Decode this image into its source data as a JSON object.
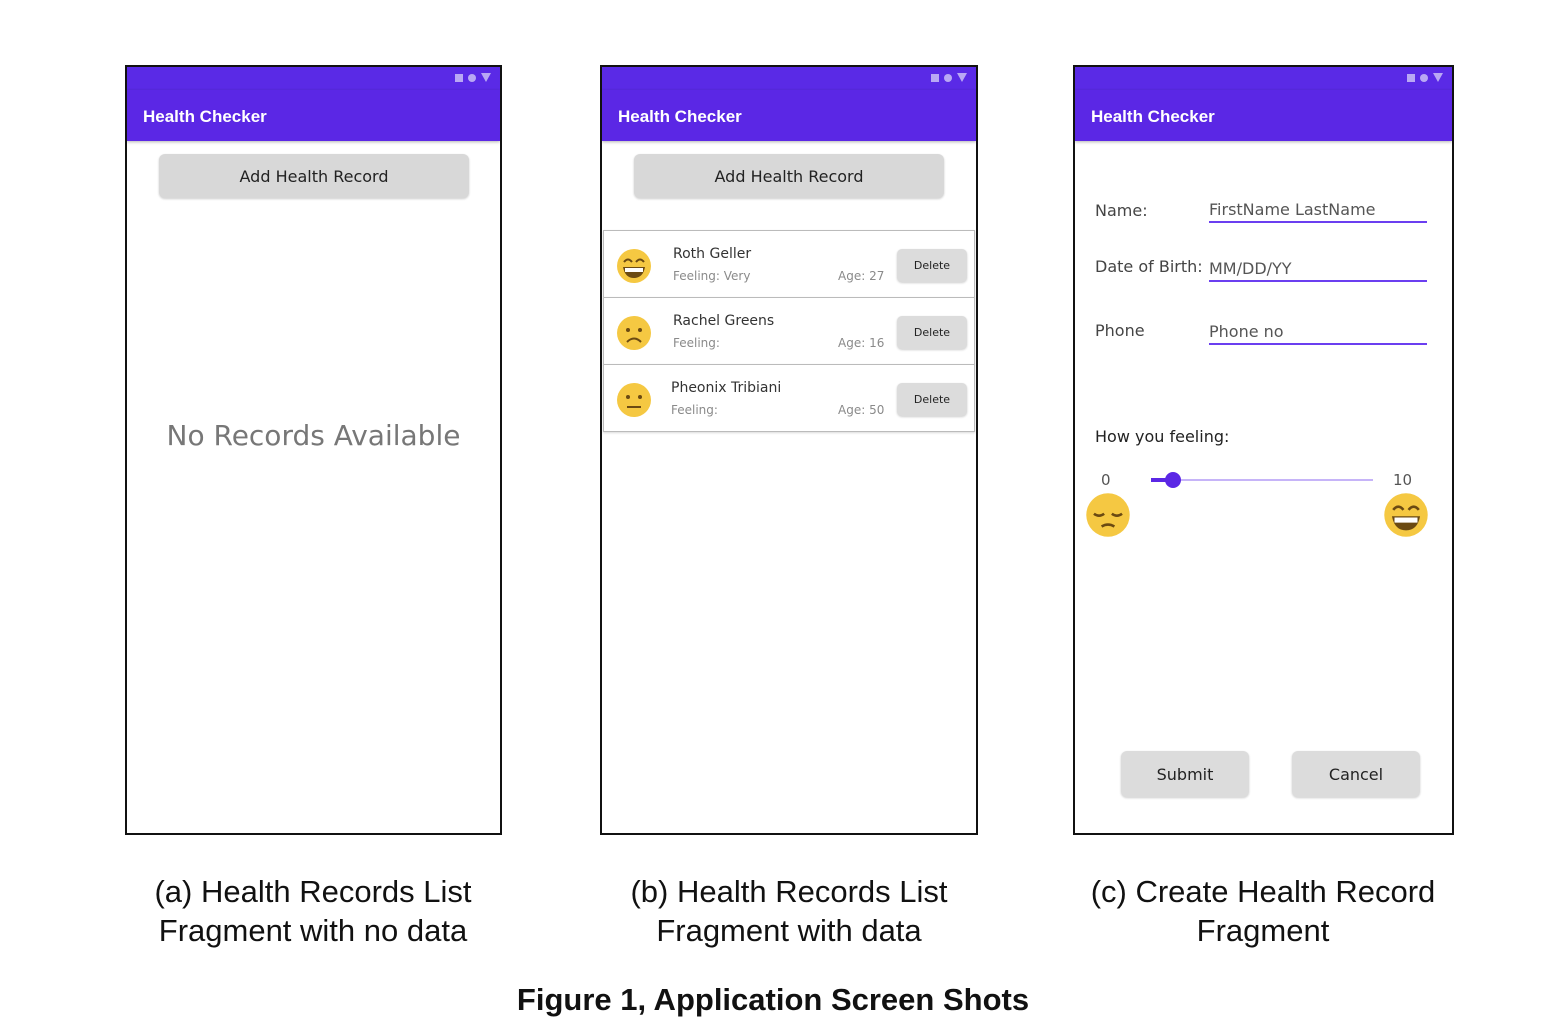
{
  "app_title": "Health Checker",
  "colors": {
    "primary": "#5b27e5",
    "status_bar": "#5a2ae6",
    "button_gray": "#d8d8d8",
    "emoji_yellow": "#f5c842"
  },
  "screen_a": {
    "add_button_label": "Add Health Record",
    "empty_message": "No Records Available"
  },
  "screen_b": {
    "add_button_label": "Add Health Record",
    "records": [
      {
        "name": "Roth Geller",
        "feeling": "Feeling: Very",
        "age": "Age: 27",
        "delete_label": "Delete",
        "emoji": "grinning-emoji-icon"
      },
      {
        "name": "Rachel Greens",
        "feeling": "Feeling:",
        "age": "Age: 16",
        "delete_label": "Delete",
        "emoji": "frowning-emoji-icon"
      },
      {
        "name": "Pheonix Tribiani",
        "feeling": "Feeling:",
        "age": "Age: 50",
        "delete_label": "Delete",
        "emoji": "neutral-emoji-icon"
      }
    ]
  },
  "screen_c": {
    "name_label": "Name:",
    "name_placeholder": "FirstName LastName",
    "dob_label": "Date of Birth:",
    "dob_placeholder": "MM/DD/YY",
    "phone_label": "Phone",
    "phone_placeholder": "Phone no",
    "feeling_label": "How you feeling:",
    "slider_min": "0",
    "slider_max": "10",
    "slider_value": 1,
    "submit_label": "Submit",
    "cancel_label": "Cancel"
  },
  "captions": {
    "a_line1": "(a) Health Records List",
    "a_line2": "Fragment with no data",
    "b_line1": "(b) Health Records List",
    "b_line2": "Fragment with data",
    "c_line1": "(c) Create Health Record",
    "c_line2": "Fragment"
  },
  "figure_title": "Figure 1, Application Screen Shots"
}
